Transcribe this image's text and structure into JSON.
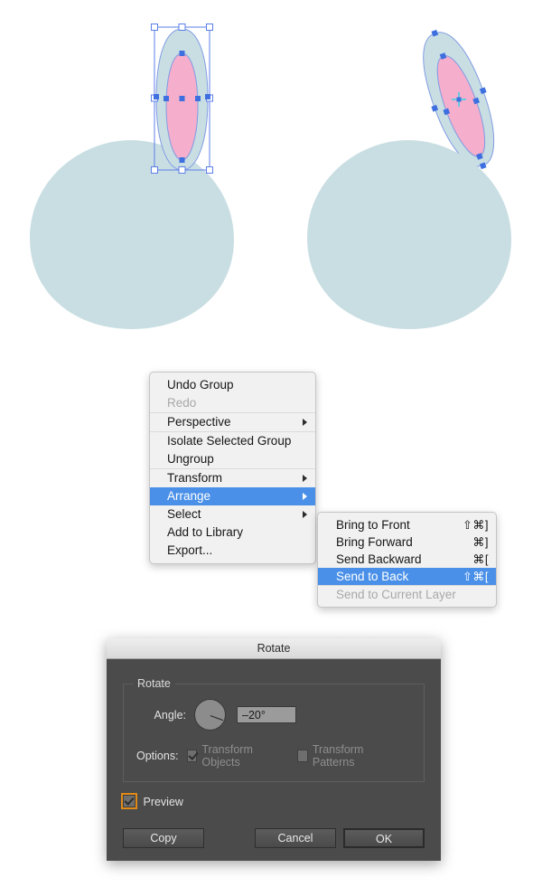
{
  "illustration": {
    "description": "Vector rabbit-head shapes before and after sending ear to back",
    "colors": {
      "body_fill": "#c9dee3",
      "ear_fill": "#c9dee3",
      "inner_ear_fill": "#f5aecb",
      "path_stroke": "#6f8fe0",
      "selection_blue": "#3e6fe0",
      "handle_fill": "#ffffff",
      "rotation_origin": "#45d0e8"
    },
    "left": {
      "label": "original-artwork",
      "state": "ear-selected-bounding-box"
    },
    "right": {
      "label": "rotated-artwork",
      "state": "ear-rotated-and-sent-to-back"
    }
  },
  "context_menu": {
    "name": "canvas-context-menu",
    "groups": [
      {
        "items": [
          {
            "label": "Undo Group",
            "disabled": false,
            "submenu": false,
            "highlighted": false
          },
          {
            "label": "Redo",
            "disabled": true,
            "submenu": false,
            "highlighted": false
          }
        ]
      },
      {
        "items": [
          {
            "label": "Perspective",
            "disabled": false,
            "submenu": true,
            "highlighted": false
          }
        ]
      },
      {
        "items": [
          {
            "label": "Isolate Selected Group",
            "disabled": false,
            "submenu": false,
            "highlighted": false
          },
          {
            "label": "Ungroup",
            "disabled": false,
            "submenu": false,
            "highlighted": false
          }
        ]
      },
      {
        "items": [
          {
            "label": "Transform",
            "disabled": false,
            "submenu": true,
            "highlighted": false
          },
          {
            "label": "Arrange",
            "disabled": false,
            "submenu": true,
            "highlighted": true
          },
          {
            "label": "Select",
            "disabled": false,
            "submenu": true,
            "highlighted": false
          },
          {
            "label": "Add to Library",
            "disabled": false,
            "submenu": false,
            "highlighted": false
          },
          {
            "label": "Export...",
            "disabled": false,
            "submenu": false,
            "highlighted": false
          }
        ]
      }
    ]
  },
  "arrange_submenu": {
    "name": "arrange-submenu",
    "groups": [
      {
        "items": [
          {
            "label": "Bring to Front",
            "shortcut": "⇧⌘]",
            "disabled": false,
            "highlighted": false
          },
          {
            "label": "Bring Forward",
            "shortcut": "⌘]",
            "disabled": false,
            "highlighted": false
          },
          {
            "label": "Send Backward",
            "shortcut": "⌘[",
            "disabled": false,
            "highlighted": false
          },
          {
            "label": "Send to Back",
            "shortcut": "⇧⌘[",
            "disabled": false,
            "highlighted": true
          }
        ]
      },
      {
        "items": [
          {
            "label": "Send to Current Layer",
            "shortcut": "",
            "disabled": true,
            "highlighted": false
          }
        ]
      }
    ]
  },
  "rotate_dialog": {
    "title": "Rotate",
    "fieldset_legend": "Rotate",
    "angle_label": "Angle:",
    "angle_value": "–20°",
    "angle_degrees": -20,
    "options_label": "Options:",
    "transform_objects": {
      "label": "Transform Objects",
      "checked": true,
      "disabled": true
    },
    "transform_patterns": {
      "label": "Transform Patterns",
      "checked": false,
      "disabled": true
    },
    "preview": {
      "label": "Preview",
      "checked": true,
      "focused": true
    },
    "buttons": {
      "copy": "Copy",
      "cancel": "Cancel",
      "ok": "OK"
    }
  }
}
